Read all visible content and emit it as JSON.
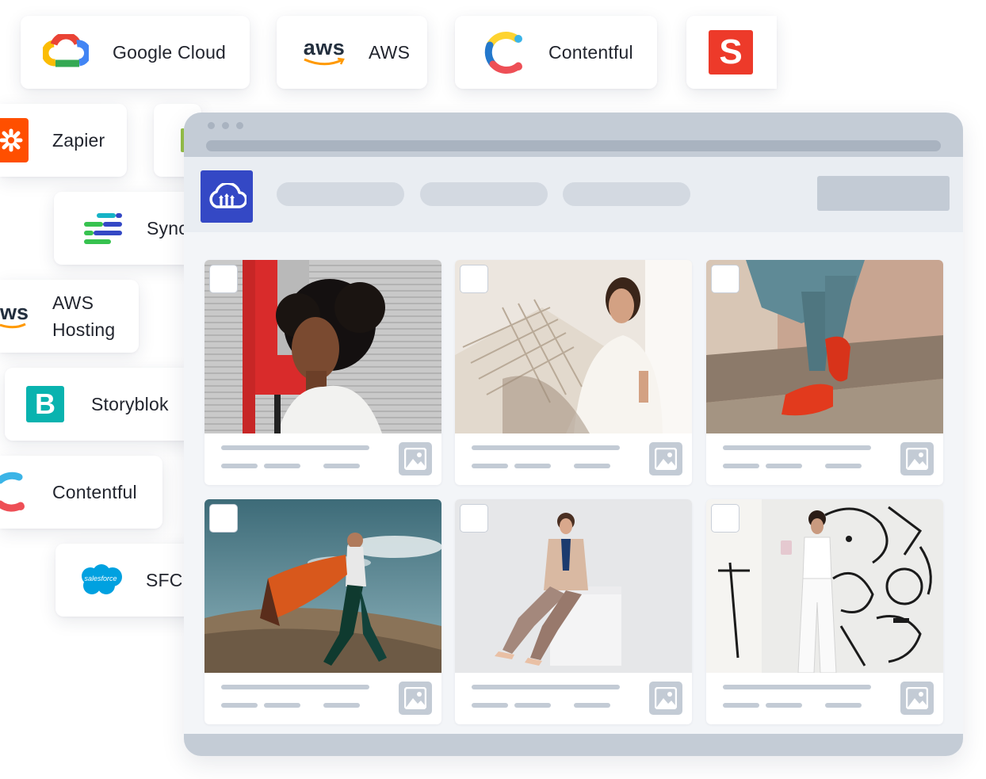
{
  "integrations": {
    "google_cloud": {
      "label": "Google Cloud"
    },
    "aws": {
      "label": "AWS",
      "logo_text": "aws"
    },
    "contentful_top": {
      "label": "Contentful"
    },
    "s_app": {
      "logo_text": "S"
    },
    "zapier": {
      "label": "Zapier"
    },
    "sync": {
      "label": "Sync"
    },
    "aws_hosting": {
      "label_line1": "AWS",
      "label_line2": "Hosting",
      "logo_text": "ws"
    },
    "storyblok": {
      "label": "Storyblok",
      "logo_text": "B"
    },
    "contentful_bottom": {
      "label": "Contentful"
    },
    "salesforce": {
      "label": "SFC",
      "logo_text": "salesforce"
    }
  },
  "app": {
    "logo_icon": "cloudinary-cloud-icon",
    "nav_pills": 3
  },
  "gallery": {
    "tiles": [
      {
        "subject": "woman-curly-hair-red-wall",
        "selected": false,
        "type_icon": "image-icon"
      },
      {
        "subject": "woman-in-hammock",
        "selected": false,
        "type_icon": "image-icon"
      },
      {
        "subject": "red-loafers-on-steps",
        "selected": false,
        "type_icon": "image-icon"
      },
      {
        "subject": "woman-orange-scarf-sky",
        "selected": false,
        "type_icon": "image-icon"
      },
      {
        "subject": "woman-sitting-white-cube",
        "selected": false,
        "type_icon": "image-icon"
      },
      {
        "subject": "woman-white-outfit-graffiti-wall",
        "selected": false,
        "type_icon": "image-icon"
      }
    ]
  },
  "colors": {
    "brand_blue": "#3448c5",
    "chrome_gray": "#c4ccd6",
    "toolbar_bg": "#e9edf2",
    "zapier_orange": "#ff4f00",
    "s_app_red": "#ed3a2a",
    "storyblok_teal": "#09b3af",
    "salesforce_blue": "#00a1e0"
  }
}
